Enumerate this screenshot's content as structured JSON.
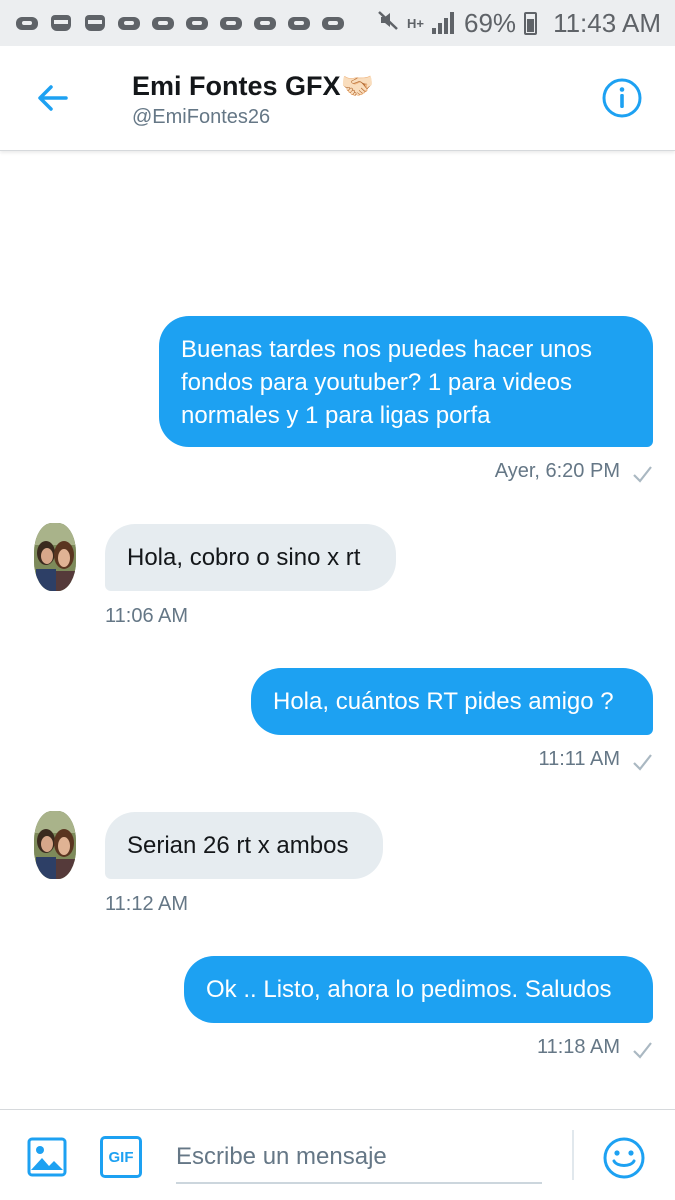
{
  "status_bar": {
    "battery": "69%",
    "time": "11:43 AM",
    "network": "H+",
    "notification_icons": [
      "game-controller-icon",
      "ninja-icon",
      "ninja-icon",
      "game-controller-icon",
      "game-controller-icon",
      "game-controller-icon",
      "game-controller-icon",
      "game-controller-icon",
      "game-controller-icon",
      "game-controller-icon"
    ]
  },
  "header": {
    "name": "Emi Fontes GFX🤝🏻",
    "handle": "@EmiFontes26"
  },
  "messages": [
    {
      "direction": "out",
      "text": "Buenas tardes nos puedes hacer unos\nfondos para youtuber? 1 para videos\nnormales y 1 para ligas porfa",
      "time": "Ayer, 6:20 PM"
    },
    {
      "direction": "in",
      "text": "Hola, cobro o sino x rt",
      "time": "11:06 AM"
    },
    {
      "direction": "out",
      "text": "Hola, cuántos RT pides amigo ?",
      "time": "11:11 AM"
    },
    {
      "direction": "in",
      "text": "Serian 26 rt x ambos",
      "time": "11:12 AM"
    },
    {
      "direction": "out",
      "text": "Ok .. Listo, ahora lo pedimos. Saludos",
      "time": "11:18 AM"
    }
  ],
  "composer": {
    "placeholder": "Escribe un mensaje",
    "gif_label": "GIF"
  },
  "colors": {
    "accent": "#1da1f2",
    "incoming_bubble": "#e6ecf0",
    "secondary_text": "#657786"
  }
}
